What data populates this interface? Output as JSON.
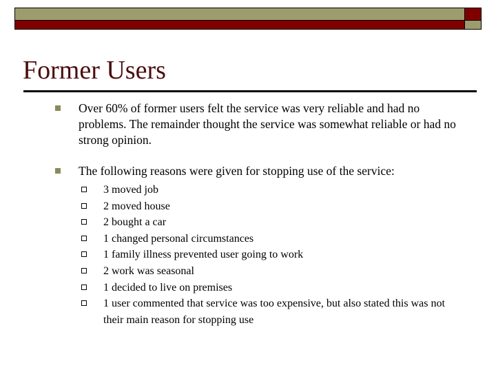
{
  "slide": {
    "title": "Former Users",
    "theme": {
      "title_color": "#4a0d10",
      "banner_olive": "#9d9c6e",
      "banner_maroon": "#800000",
      "bullet_level1_color": "#8a8a5c",
      "bullet_level2_color": "#000000",
      "rule_color": "#000000",
      "body_text_color": "#000000",
      "background": "#ffffff"
    },
    "banner": {
      "olive_band_name": "olive-band",
      "maroon_band_name": "maroon-band",
      "maroon_square_name": "maroon-accent-square",
      "olive_square_name": "olive-accent-square"
    },
    "bullets": [
      {
        "marker": "filled-square-bullet",
        "text": "Over 60% of former users felt the service was very reliable and had no problems.  The remainder thought the service was somewhat reliable or had no strong opinion.",
        "sub_bullets": []
      },
      {
        "marker": "filled-square-bullet",
        "text": "The following reasons were given for stopping use of the service:",
        "sub_bullets": [
          {
            "marker": "hollow-square-bullet",
            "text": "3 moved job"
          },
          {
            "marker": "hollow-square-bullet",
            "text": "2 moved house"
          },
          {
            "marker": "hollow-square-bullet",
            "text": "2 bought a car"
          },
          {
            "marker": "hollow-square-bullet",
            "text": "1 changed personal circumstances"
          },
          {
            "marker": "hollow-square-bullet",
            "text": "1 family illness prevented user going to work"
          },
          {
            "marker": "hollow-square-bullet",
            "text": "2 work was seasonal"
          },
          {
            "marker": "hollow-square-bullet",
            "text": "1 decided to live on premises"
          },
          {
            "marker": "hollow-square-bullet",
            "text": "1 user commented that service was too expensive, but also stated this was not their main reason for stopping use"
          }
        ]
      }
    ]
  }
}
